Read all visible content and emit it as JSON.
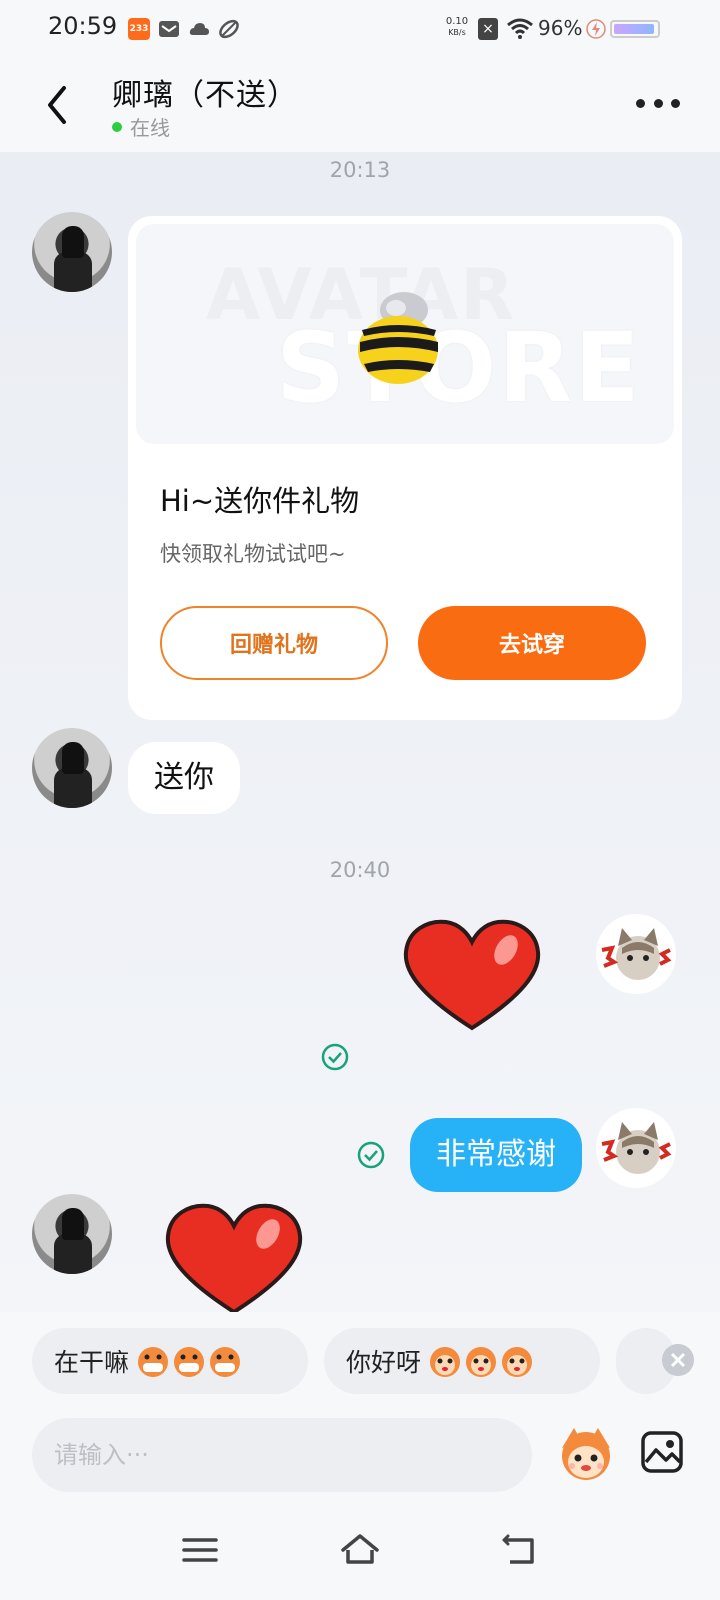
{
  "status_bar": {
    "time": "20:59",
    "app_badge": "233",
    "net_speed_value": "0.10",
    "net_speed_unit": "KB/s",
    "battery": "96%",
    "icons": [
      "game-233-icon",
      "mail-icon",
      "cloud-icon",
      "leaf-icon",
      "no-sim-icon",
      "wifi-icon",
      "charging-icon",
      "battery-icon"
    ]
  },
  "header": {
    "title": "卿璃（不送）",
    "status": "在线",
    "status_color": "#2ecc40"
  },
  "chat": {
    "timestamp_1": "20:13",
    "gift_card": {
      "title": "Hi~送你件礼物",
      "subtitle": "快领取礼物试试吧~",
      "return_button": "回赠礼物",
      "try_button": "去试穿",
      "banner_text_1": "AVATAR",
      "banner_text_2": "STORE"
    },
    "message_1": "送你",
    "timestamp_2": "20:40",
    "message_2": "非常感谢",
    "accent_color": "#fa6c12",
    "bubble_color": "#27b2f7"
  },
  "quick_replies": [
    {
      "text": "在干嘛"
    },
    {
      "text": "你好呀"
    }
  ],
  "input": {
    "placeholder": "请输入···"
  },
  "nav": {
    "icons": [
      "menu-icon",
      "home-icon",
      "back-icon"
    ]
  }
}
